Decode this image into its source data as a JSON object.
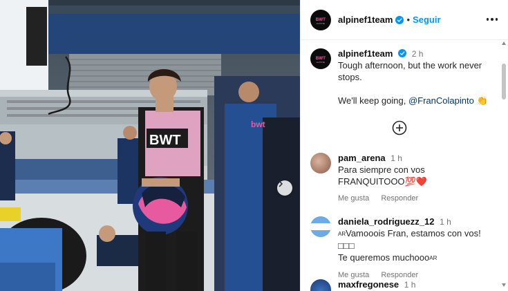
{
  "photo": {
    "alt_description_shown": "",
    "shirt_logo": "BWT",
    "next_icon": "chevron-right-icon"
  },
  "header": {
    "username": "alpinef1team",
    "separator": "•",
    "follow_label": "Seguir",
    "more_icon": "more-horizontal-icon"
  },
  "caption": {
    "username": "alpinef1team",
    "time": "2 h",
    "text_line1": "Tough afternoon, but the work never",
    "text_line2": "stops.",
    "text_line3_prefix": "We'll keep going, ",
    "mention": "@FranColapinto",
    "emoji": "👏"
  },
  "load_more_icon": "plus-circle-icon",
  "comments": [
    {
      "username": "pam_arena",
      "time": "1 h",
      "line1": "Para siempre con vos",
      "line2": "FRANQUITOOO💯❤️",
      "like_label": "Me gusta",
      "reply_label": "Responder"
    },
    {
      "username": "daniela_rodriguezz_12",
      "time": "1 h",
      "line1_flag": "AR",
      "line1": "Vamooois Fran, estamos con vos!□□□",
      "line2": "Te queremos muchooo",
      "line2_flag": "AR",
      "like_label": "Me gusta",
      "reply_label": "Responder"
    },
    {
      "username": "maxfregonese",
      "time": "1 h"
    }
  ],
  "colors": {
    "accent_blue": "#0095f6",
    "alpine_pink": "#e85aa0",
    "alpine_blue": "#1e4c9a"
  }
}
